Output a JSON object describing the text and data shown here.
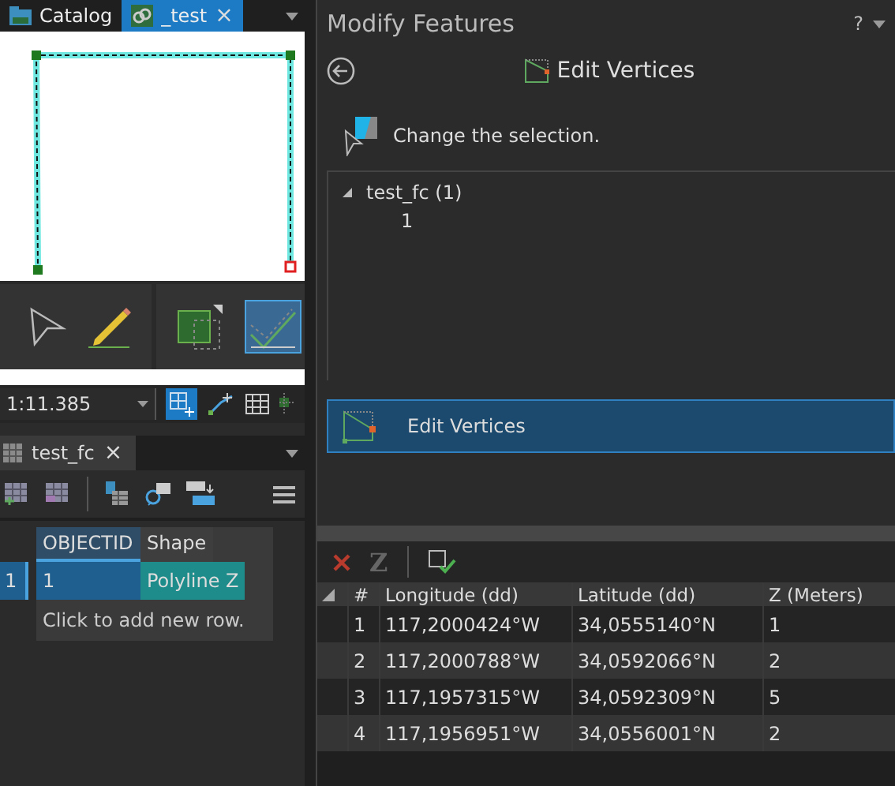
{
  "left_tabs": [
    {
      "label": "Catalog",
      "selected": false,
      "closable": false
    },
    {
      "label": "_test",
      "selected": true,
      "closable": true
    }
  ],
  "close_glyph": "×",
  "scale": {
    "value": "1:11.385"
  },
  "table_tab": {
    "label": "test_fc"
  },
  "attribute_table": {
    "columns": [
      "OBJECTID",
      "Shape"
    ],
    "rows": [
      {
        "row_header": "1",
        "cells": [
          "1",
          "Polyline Z"
        ],
        "selected": true
      }
    ],
    "new_row_hint": "Click to add new row."
  },
  "panel": {
    "title": "Modify Features",
    "help": "?",
    "tool_title": "Edit Vertices",
    "selection_hint": "Change the selection.",
    "tree": [
      {
        "label": "test_fc (1)",
        "expanded": true,
        "children": [
          {
            "label": "1"
          }
        ]
      }
    ],
    "tool_item": {
      "label": "Edit Vertices",
      "selected": true
    },
    "z_button": "Z",
    "vertices": {
      "columns": [
        "#",
        "Longitude (dd)",
        "Latitude (dd)",
        "Z (Meters)"
      ],
      "rows": [
        [
          "1",
          "117,2000424°W",
          "34,0555140°N",
          "1"
        ],
        [
          "2",
          "117,2000788°W",
          "34,0592066°N",
          "2"
        ],
        [
          "3",
          "117,1957315°W",
          "34,0592309°N",
          "5"
        ],
        [
          "4",
          "117,1956951°W",
          "34,0556001°N",
          "2"
        ]
      ]
    }
  }
}
